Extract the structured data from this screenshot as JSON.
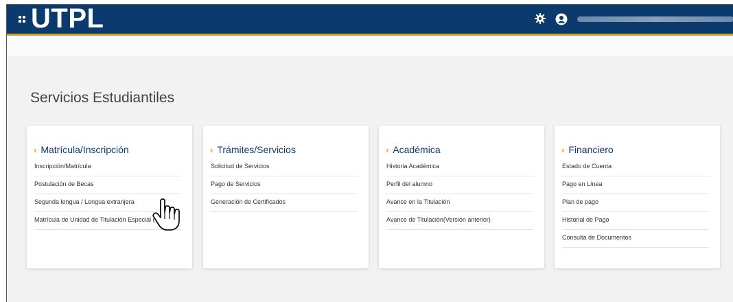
{
  "header": {
    "brand": "UTPL",
    "username": "████████████████"
  },
  "page": {
    "title": "Servicios Estudiantiles"
  },
  "cards": [
    {
      "title": "Matrícula/Inscripción",
      "links": [
        "Inscripción/Matrícula",
        "Postulación de Becas",
        "Segunda lengua / Lengua extranjera",
        "Matrícula de Unidad de Titulación Especial (UTE)"
      ]
    },
    {
      "title": "Trámites/Servicios",
      "links": [
        "Solicitud de Servicios",
        "Pago de Servicios",
        "Generación de Certificados"
      ]
    },
    {
      "title": "Académica",
      "links": [
        "Historia Académica",
        "Perfil del alumno",
        "Avance en la Titulación",
        "Avance de Titulación(Versión anterior)"
      ]
    },
    {
      "title": "Financiero",
      "links": [
        "Estado de Cuenta",
        "Pago en Línea",
        "Plan de pago",
        "Historial de Pago",
        "Consulta de Documentos"
      ]
    }
  ],
  "colors": {
    "header_bg": "#0b3a6e",
    "accent": "#c9a227",
    "chevron": "#e0a91b"
  },
  "icons": [
    "grid-menu-icon",
    "gear-icon",
    "user-icon",
    "chevron-right-icon",
    "hand-cursor-icon"
  ]
}
